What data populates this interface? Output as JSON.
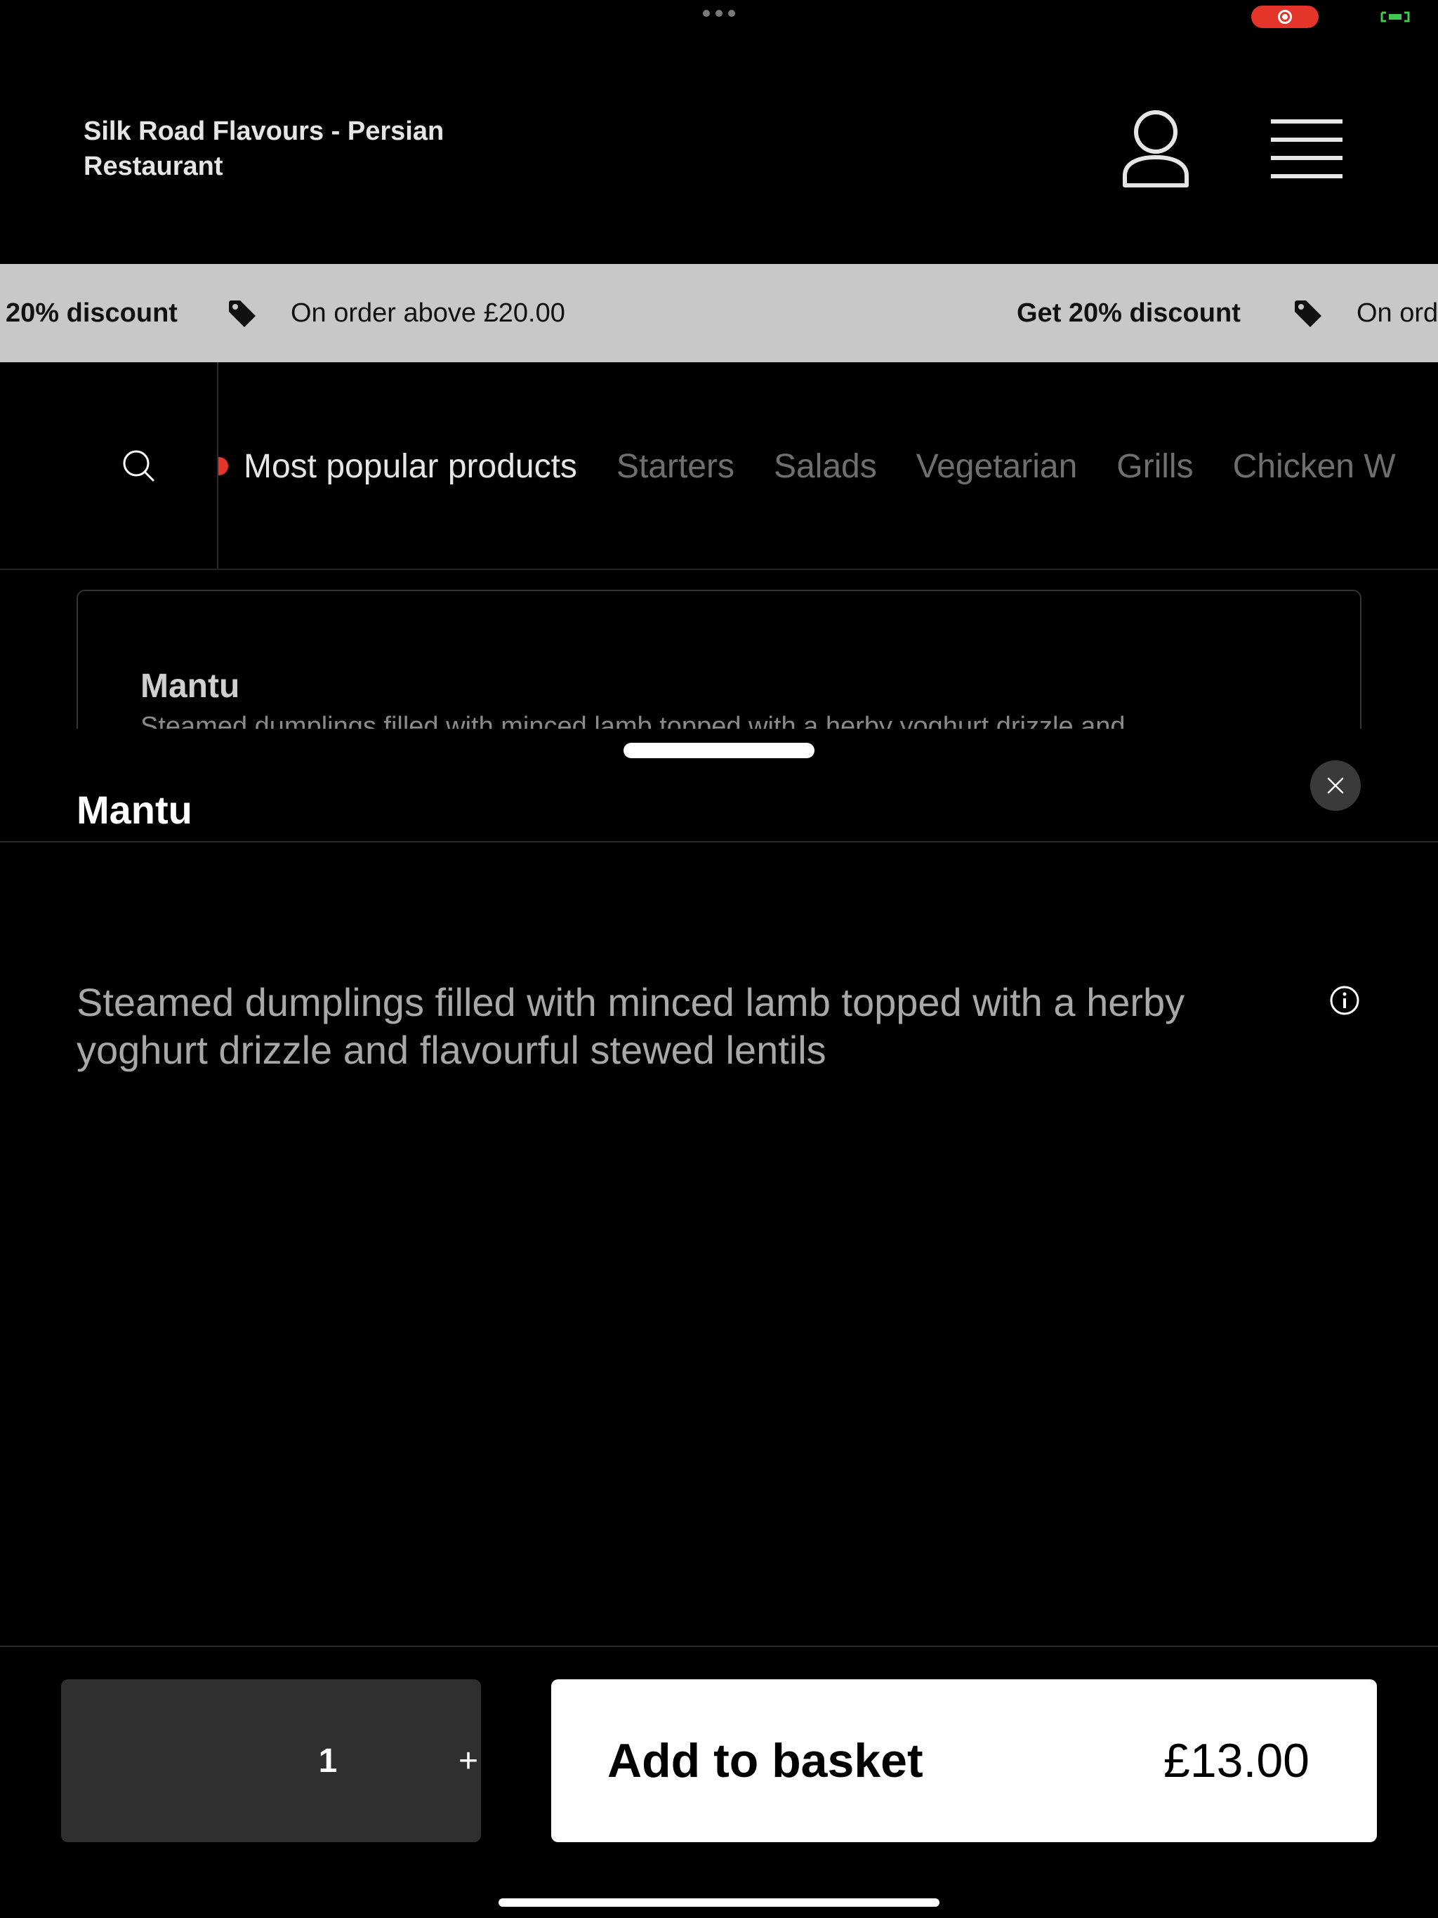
{
  "header": {
    "title": "Silk Road Flavours - Persian Restaurant",
    "profile_icon": "user-icon",
    "menu_icon": "hamburger-menu-icon"
  },
  "promo": {
    "items": [
      {
        "text": "20% discount"
      },
      {
        "text": "On order above £20.00"
      },
      {
        "text": "Get 20% discount"
      },
      {
        "text": "On ord"
      }
    ],
    "tag_icon": "tag-icon"
  },
  "categories": {
    "search_icon": "search-icon",
    "tabs": [
      {
        "label": "Most popular products"
      },
      {
        "label": "Starters"
      },
      {
        "label": "Salads"
      },
      {
        "label": "Vegetarian"
      },
      {
        "label": "Grills"
      },
      {
        "label": "Chicken W"
      }
    ],
    "active_index": 0
  },
  "product_card": {
    "name": "Mantu",
    "description": "Steamed dumplings filled with minced lamb topped with a herby yoghurt drizzle and"
  },
  "sheet": {
    "title": "Mantu",
    "description": "Steamed dumplings filled with minced lamb topped with a herby yoghurt drizzle and flavourful stewed lentils",
    "quantity": "1",
    "plus_label": "+",
    "add_label": "Add to basket",
    "price": "£13.00"
  },
  "colors": {
    "background": "#000000",
    "promo_bg": "#c8c8c8",
    "accent_red": "#e5352b",
    "add_button_bg": "#ffffff",
    "qty_bg": "#2f2f2f"
  }
}
